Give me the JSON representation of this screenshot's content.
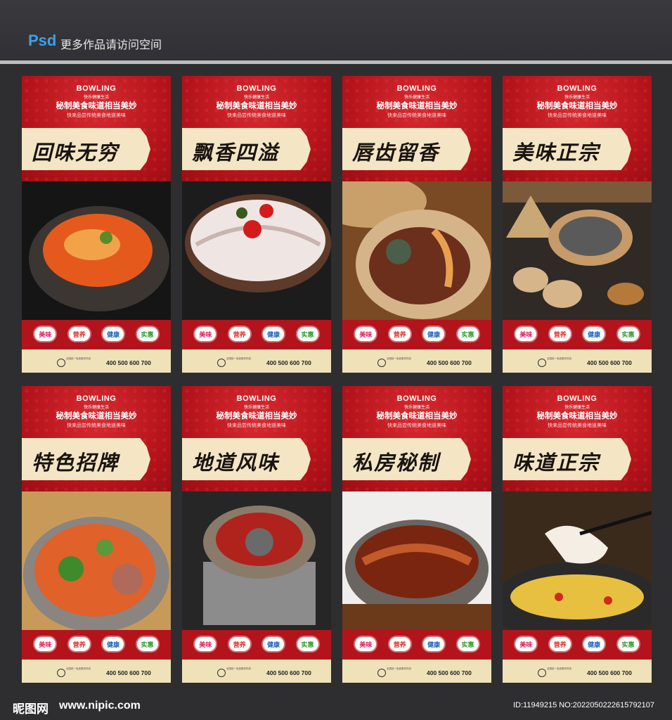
{
  "header": {
    "psd_label": "Psd",
    "visit_text": "更多作品请访问空间"
  },
  "badge_colors": {
    "美味": "#e01f5b",
    "营养": "#e0332a",
    "健康": "#1e63c8",
    "实惠": "#2e9a2a"
  },
  "posters": [
    {
      "brand": "BOWLING",
      "tagline": "快乐健康生活",
      "headline": "秘制美食味道相当美妙",
      "subline": "快来品尝传统美食地道美味",
      "banner": "回味无穷",
      "badges": [
        "美味",
        "营养",
        "健康",
        "实惠"
      ],
      "phone": "400 500 600 700",
      "fine": "全国统一免费服务热线"
    },
    {
      "brand": "BOWLING",
      "tagline": "快乐健康生活",
      "headline": "秘制美食味道相当美妙",
      "subline": "快来品尝传统美食地道美味",
      "banner": "飘香四溢",
      "badges": [
        "美味",
        "营养",
        "健康",
        "实惠"
      ],
      "phone": "400 500 600 700",
      "fine": "全国统一免费服务热线"
    },
    {
      "brand": "BOWLING",
      "tagline": "快乐健康生活",
      "headline": "秘制美食味道相当美妙",
      "subline": "快来品尝传统美食地道美味",
      "banner": "唇齿留香",
      "badges": [
        "美味",
        "营养",
        "健康",
        "实惠"
      ],
      "phone": "400 500 600 700",
      "fine": "全国统一免费服务热线"
    },
    {
      "brand": "BOWLING",
      "tagline": "快乐健康生活",
      "headline": "秘制美食味道相当美妙",
      "subline": "快来品尝传统美食地道美味",
      "banner": "美味正宗",
      "badges": [
        "美味",
        "营养",
        "健康",
        "实惠"
      ],
      "phone": "400 500 600 700",
      "fine": "全国统一免费服务热线"
    },
    {
      "brand": "BOWLING",
      "tagline": "快乐健康生活",
      "headline": "秘制美食味道相当美妙",
      "subline": "快来品尝传统美食地道美味",
      "banner": "特色招牌",
      "badges": [
        "美味",
        "营养",
        "健康",
        "实惠"
      ],
      "phone": "400 500 600 700",
      "fine": "全国统一免费服务热线"
    },
    {
      "brand": "BOWLING",
      "tagline": "快乐健康生活",
      "headline": "秘制美食味道相当美妙",
      "subline": "快来品尝传统美食地道美味",
      "banner": "地道风味",
      "badges": [
        "美味",
        "营养",
        "健康",
        "实惠"
      ],
      "phone": "400 500 600 700",
      "fine": "全国统一免费服务热线"
    },
    {
      "brand": "BOWLING",
      "tagline": "快乐健康生活",
      "headline": "秘制美食味道相当美妙",
      "subline": "快来品尝传统美食地道美味",
      "banner": "私房秘制",
      "badges": [
        "美味",
        "营养",
        "健康",
        "实惠"
      ],
      "phone": "400 500 600 700",
      "fine": "全国统一免费服务热线"
    },
    {
      "brand": "BOWLING",
      "tagline": "快乐健康生活",
      "headline": "秘制美食味道相当美妙",
      "subline": "快来品尝传统美食地道美味",
      "banner": "味道正宗",
      "badges": [
        "美味",
        "营养",
        "健康",
        "实惠"
      ],
      "phone": "400 500 600 700",
      "fine": "全国统一免费服务热线"
    }
  ],
  "footer": {
    "watermark": "昵图网",
    "site": "www.nipic.com",
    "id_text": "ID:11949215 NO:20220502226157921​07"
  }
}
